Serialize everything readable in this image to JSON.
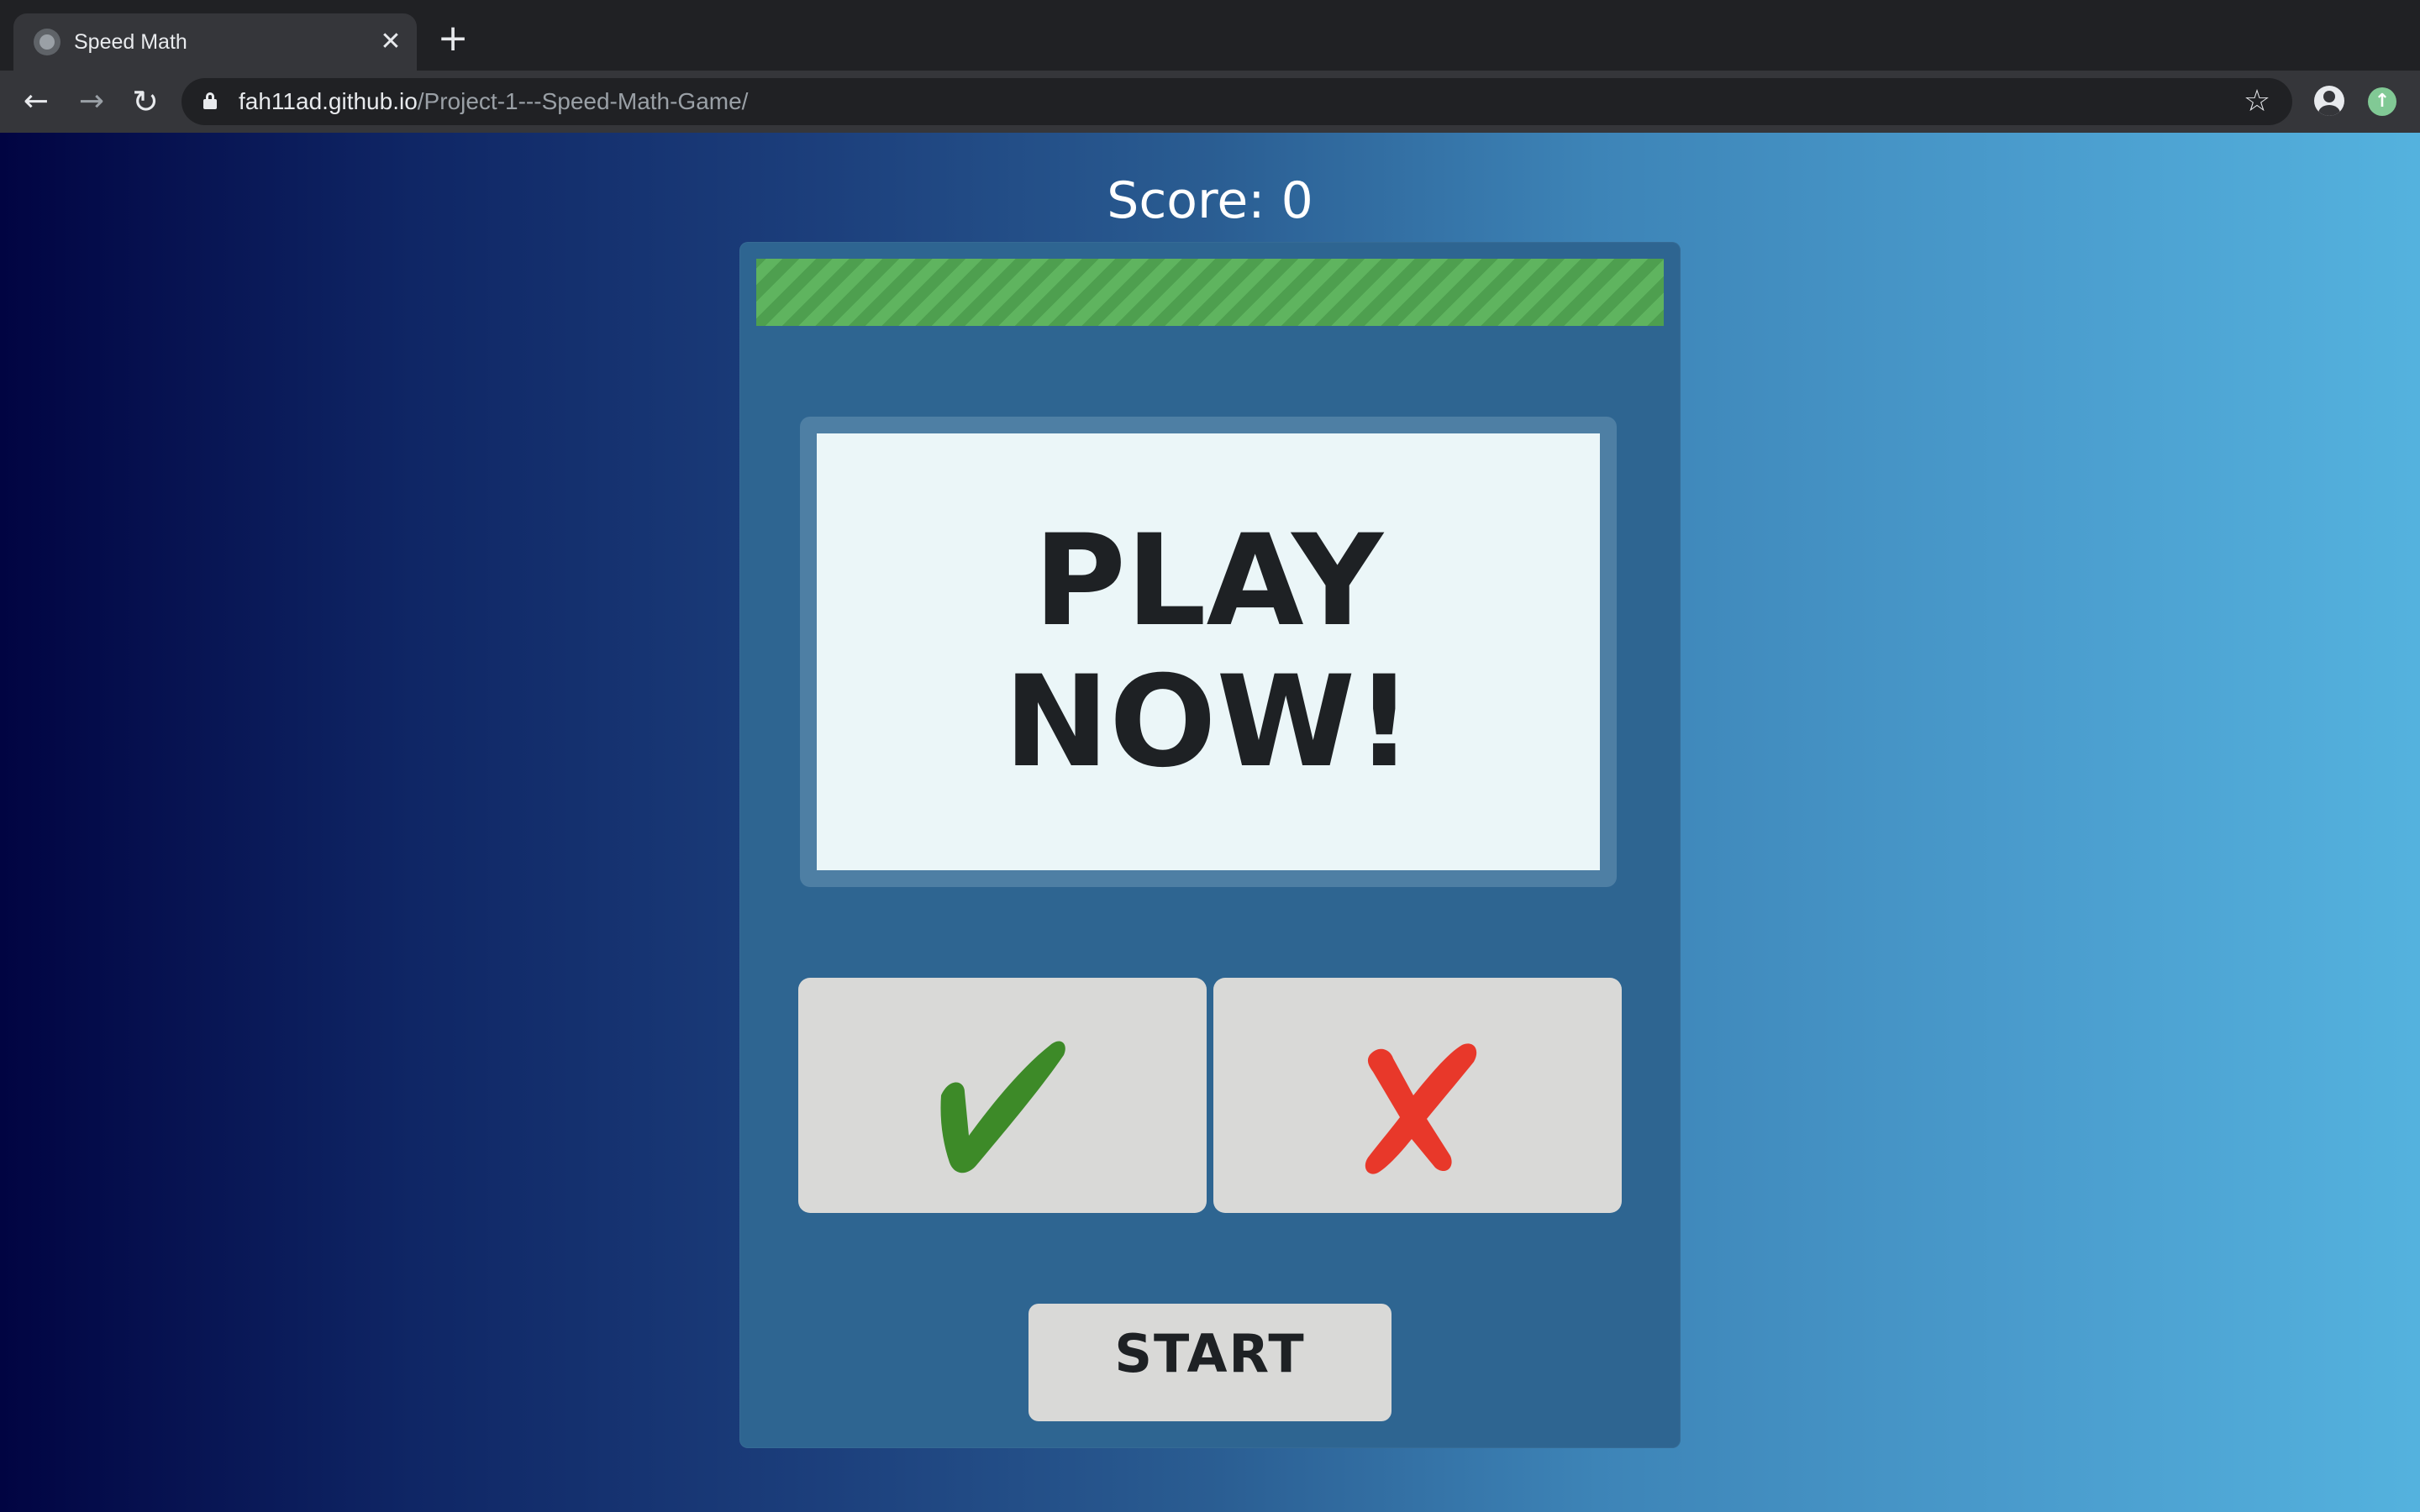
{
  "browser": {
    "tab": {
      "title": "Speed Math",
      "favicon": "globe-icon"
    },
    "url_host": "fah11ad.github.io",
    "url_path": "/Project-1---Speed-Math-Game/",
    "new_tab_symbol": "+",
    "close_symbol": "✕"
  },
  "game": {
    "score_text": "Score: 0",
    "timer_progress": 1.0,
    "timer_color": "#5fb45f",
    "question_text": "PLAY NOW!",
    "correct_button": {
      "icon": "checkmark-icon",
      "color": "#3d8a28"
    },
    "wrong_button": {
      "icon": "cross-icon",
      "color": "#e8382a"
    },
    "start_label": "START"
  },
  "colors": {
    "panel": "#2e6591",
    "question_background": "#ebf6f8",
    "button_background": "#d9d9d7"
  }
}
